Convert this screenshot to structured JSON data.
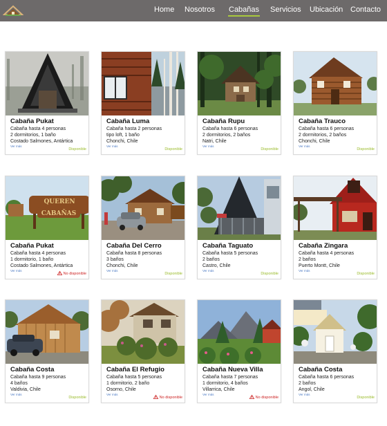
{
  "nav": {
    "items": [
      "Home",
      "Nosotros",
      "Cabañas",
      "Servicios",
      "Ubicación",
      "Contacto"
    ],
    "active": "Cabañas"
  },
  "colors": {
    "navbar": "#6d6a6a",
    "accent": "#a9c93d",
    "available": "#9bbc2c",
    "unavailable": "#cc2222",
    "link": "#4a78c2"
  },
  "cards": [
    {
      "title": "Cabaña Pukat",
      "line1": "Cabaña hasta 4 personas",
      "line2": "2 dormitorios, 1 baño",
      "location": "Costado Salmones, Antártica",
      "more": "Ver más",
      "status": "Disponible",
      "available": true,
      "scene": "a-frame-fog"
    },
    {
      "title": "Cabaña Luma",
      "line1": "Cabaña hasta 2 personas",
      "line2": "tipo loft, 1 baño",
      "location": "Chonchi, Chile",
      "more": "Ver más",
      "status": "Disponible",
      "available": true,
      "scene": "wood-cabin-window-lake"
    },
    {
      "title": "Cabaña Rupu",
      "line1": "Cabaña hasta 6 personas",
      "line2": "2 dormitorios, 2 baños",
      "location": "Natri, Chile",
      "more": "Ver más",
      "status": "Disponible",
      "available": true,
      "scene": "cabin-in-forest"
    },
    {
      "title": "Cabaña Trauco",
      "line1": "Cabaña hasta 6 personas",
      "line2": "2 dormitorios, 2 baños",
      "location": "Chonchi, Chile",
      "more": "Ver más",
      "status": "Disponible",
      "available": true,
      "scene": "log-cabin-sky"
    },
    {
      "title": "Cabaña Pukat",
      "line1": "Cabaña hasta 4 personas",
      "line2": "1 dormitorio, 1 baño",
      "location": "Costado Salmones, Antártica",
      "more": "Ver más",
      "status": "No disponible",
      "available": false,
      "scene": "cabanas-sign"
    },
    {
      "title": "Cabaña Del Cerro",
      "line1": "Cabaña hasta 8 personas",
      "line2": "3 baños",
      "location": "Chonchi, Chile",
      "more": "Ver más",
      "status": "Disponible",
      "available": true,
      "scene": "cabin-car-trees"
    },
    {
      "title": "Cabaña Taguato",
      "line1": "Cabaña hasta 5 personas",
      "line2": "2 baños",
      "location": "Castro, Chile",
      "more": "Ver más",
      "status": "Disponible",
      "available": true,
      "scene": "modern-dark-roof"
    },
    {
      "title": "Cabaña Zingara",
      "line1": "Cabaña hasta 4 personas",
      "line2": "2 baños",
      "location": "Puerto Montt, Chile",
      "more": "Ver más",
      "status": "Disponible",
      "available": true,
      "scene": "red-cabin"
    },
    {
      "title": "Cabaña Costa",
      "line1": "Cabaña hasta 9 personas",
      "line2": "4 baños",
      "location": "Valdivia, Chile",
      "more": "Ver más",
      "status": "Disponible",
      "available": true,
      "scene": "wood-house-car"
    },
    {
      "title": "Cabaña El Refugio",
      "line1": "Cabaña hasta 5 personas",
      "line2": "1 dormitorio, 2 baño",
      "location": "Osorno, Chile",
      "more": "Ver más",
      "status": "No disponible",
      "available": false,
      "scene": "stone-house-garden"
    },
    {
      "title": "Cabaña Nueva Villa",
      "line1": "Cabaña hasta 7 personas",
      "line2": "1 dormitorio, 4  baños",
      "location": "Villarrica, Chile",
      "more": "Ver más",
      "status": "No disponible",
      "available": false,
      "scene": "mountain-garden"
    },
    {
      "title": "Cabaña Costa",
      "line1": "Cabaña hasta 6 personas",
      "line2": "2 baños",
      "location": "Angol, Chile",
      "more": "Ver más",
      "status": "Disponible",
      "available": true,
      "scene": "white-house-trees"
    }
  ]
}
